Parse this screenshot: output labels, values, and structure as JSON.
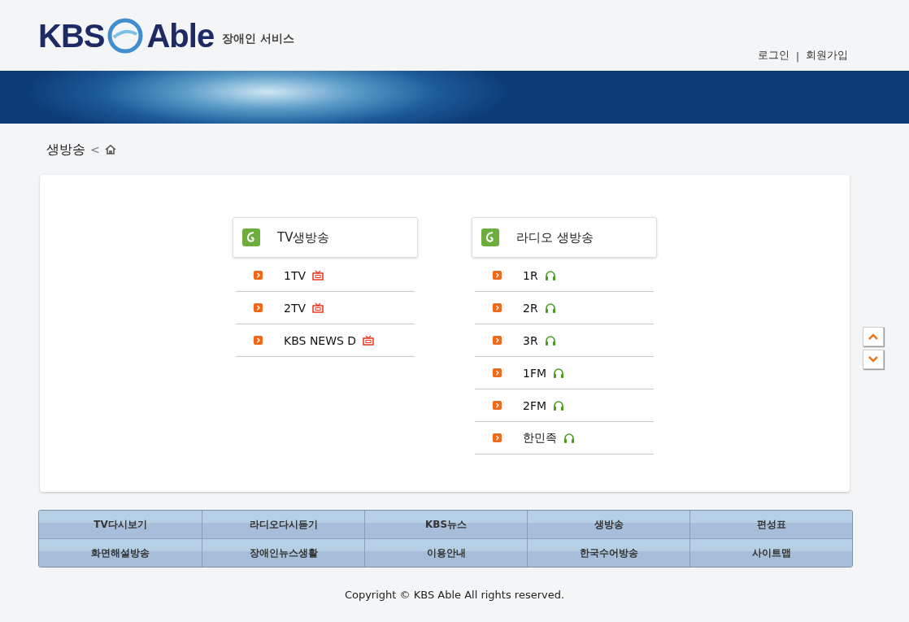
{
  "logo": {
    "left": "KBS",
    "right": "Able",
    "tagline": "장애인 서비스"
  },
  "account_links": [
    "로그인",
    "회원가입"
  ],
  "account_separator": "|",
  "breadcrumb": {
    "current": "생방송",
    "separator": "<"
  },
  "sections": [
    {
      "title": "TV생방송",
      "channels": [
        {
          "name": "1TV",
          "kind": "tv"
        },
        {
          "name": "2TV",
          "kind": "tv"
        },
        {
          "name": "KBS NEWS D",
          "kind": "tv"
        }
      ]
    },
    {
      "title": "라디오 생방송",
      "channels": [
        {
          "name": "1R",
          "kind": "radio"
        },
        {
          "name": "2R",
          "kind": "radio"
        },
        {
          "name": "3R",
          "kind": "radio"
        },
        {
          "name": "1FM",
          "kind": "radio"
        },
        {
          "name": "2FM",
          "kind": "radio"
        },
        {
          "name": "한민족",
          "kind": "radio"
        }
      ]
    }
  ],
  "footer_menu": [
    [
      "TV다시보기",
      "라디오다시듣기",
      "KBS뉴스",
      "생방송",
      "편성표"
    ],
    [
      "화면해설방송",
      "장애인뉴스생활",
      "이용안내",
      "한국수어방송",
      "사이트맵"
    ]
  ],
  "copyright": "Copyright © KBS Able All rights reserved."
}
